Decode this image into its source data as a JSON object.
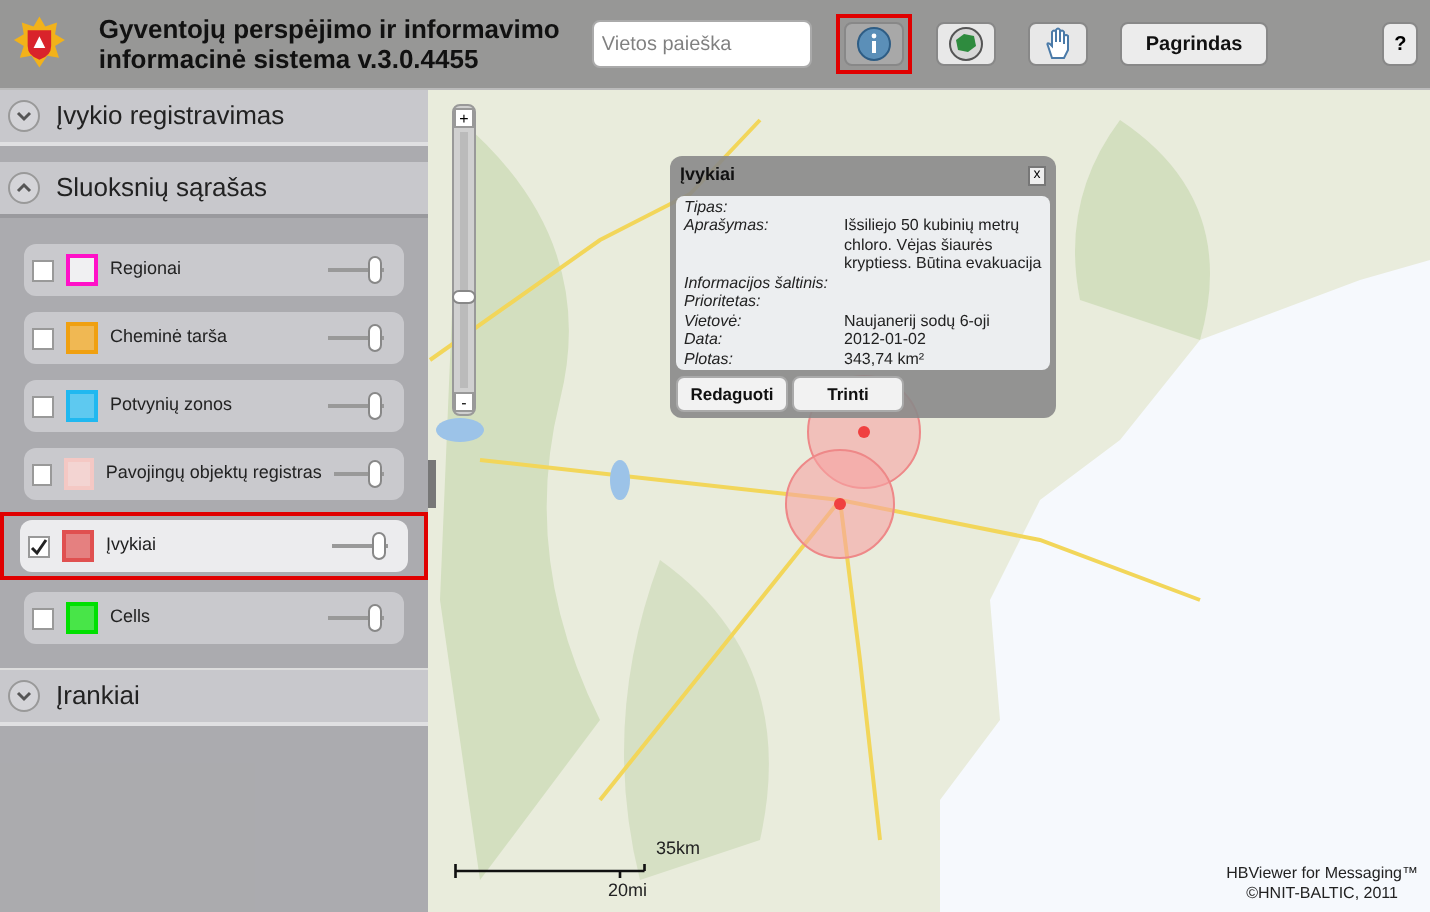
{
  "header": {
    "title_line1": "Gyventojų perspėjimo ir informavimo",
    "title_line2": "informacinė sistema v.3.0.4455",
    "search": {
      "placeholder": "Vietos paieška"
    },
    "tools": [
      {
        "kind": "info",
        "selected": true
      },
      {
        "kind": "globe",
        "selected": false
      },
      {
        "kind": "hand",
        "selected": false
      }
    ],
    "home_button": "Pagrindas",
    "help_button": "?"
  },
  "sidebar": {
    "sections": [
      {
        "title": "Įvykio registravimas",
        "expanded": false
      },
      {
        "title": "Sluoksnių sąrašas",
        "expanded": true,
        "layers": [
          {
            "label": "Regionai",
            "checked": false,
            "selected": false,
            "color": "#ff10c8",
            "level": 0.85
          },
          {
            "label": "Cheminė tarša",
            "checked": false,
            "selected": false,
            "color": "#f0a010",
            "level": 0.85
          },
          {
            "label": "Potvynių zonos",
            "checked": false,
            "selected": false,
            "color": "#20b8f0",
            "level": 0.85
          },
          {
            "label": "Pavojingų objektų registras",
            "checked": false,
            "selected": false,
            "color": "#f4c8c4",
            "level": 0.85
          },
          {
            "label": "Įvykiai",
            "checked": true,
            "selected": true,
            "color": "#e05050",
            "level": 0.85
          },
          {
            "label": "Cells",
            "checked": false,
            "selected": false,
            "color": "#00e000",
            "level": 0.85
          }
        ]
      },
      {
        "title": "Įrankiai",
        "expanded": false
      }
    ]
  },
  "map": {
    "zoom_in": "+",
    "zoom_out": "-",
    "zoom": {
      "level": 0.35
    },
    "scale_km": "35km",
    "scale_mi": "20mi"
  },
  "popup": {
    "title": "Įvykiai",
    "close": "x",
    "fields": [
      {
        "label": "Tipas:"
      },
      {
        "label": "Aprašymas:",
        "value": "Išsiliejo 50 kubinių metrų chloro. Vėjas šiaurės kryptiess. Būtina evakuacija"
      },
      {
        "label": "Informacijos šaltinis:"
      },
      {
        "label": "Prioritetas:"
      },
      {
        "label": "Vietovė:",
        "value": "Naujanerij sodų 6-oji"
      },
      {
        "label": "Data:",
        "value": "2012-01-02"
      },
      {
        "label": "Plotas:",
        "value": "343,74 km²"
      }
    ],
    "buttons": [
      "Redaguoti",
      "Trinti"
    ]
  },
  "credits": [
    "HBViewer for Messaging™",
    "©HNIT-BALTIC, 2011"
  ]
}
